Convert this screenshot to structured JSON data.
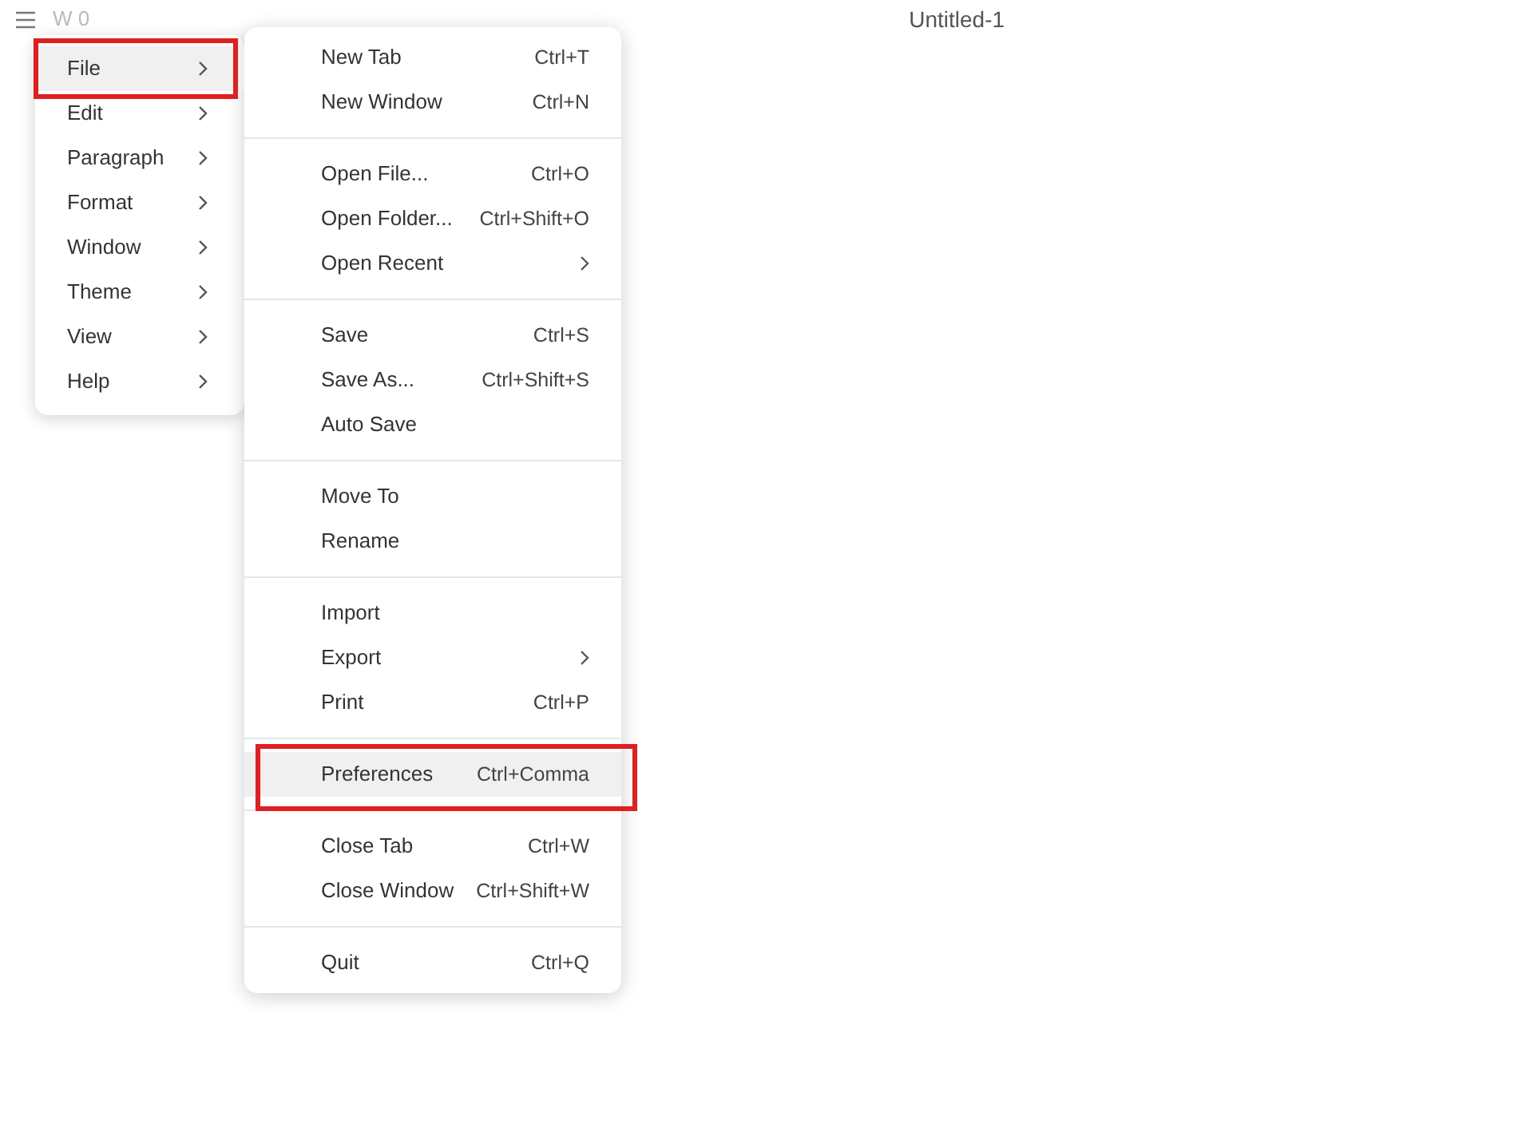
{
  "top_bar": {
    "word_count": "W 0",
    "title": "Untitled-1"
  },
  "main_menu": [
    {
      "label": "File",
      "submenu": true,
      "selected": true,
      "annotated": true
    },
    {
      "label": "Edit",
      "submenu": true,
      "selected": false,
      "annotated": false
    },
    {
      "label": "Paragraph",
      "submenu": true,
      "selected": false,
      "annotated": false
    },
    {
      "label": "Format",
      "submenu": true,
      "selected": false,
      "annotated": false
    },
    {
      "label": "Window",
      "submenu": true,
      "selected": false,
      "annotated": false
    },
    {
      "label": "Theme",
      "submenu": true,
      "selected": false,
      "annotated": false
    },
    {
      "label": "View",
      "submenu": true,
      "selected": false,
      "annotated": false
    },
    {
      "label": "Help",
      "submenu": true,
      "selected": false,
      "annotated": false
    }
  ],
  "file_menu": [
    [
      {
        "label": "New Tab",
        "shortcut": "Ctrl+T",
        "submenu": false,
        "selected": false,
        "annotated": false
      },
      {
        "label": "New Window",
        "shortcut": "Ctrl+N",
        "submenu": false,
        "selected": false,
        "annotated": false
      }
    ],
    [
      {
        "label": "Open File...",
        "shortcut": "Ctrl+O",
        "submenu": false,
        "selected": false,
        "annotated": false
      },
      {
        "label": "Open Folder...",
        "shortcut": "Ctrl+Shift+O",
        "submenu": false,
        "selected": false,
        "annotated": false
      },
      {
        "label": "Open Recent",
        "submenu": true,
        "selected": false,
        "annotated": false
      }
    ],
    [
      {
        "label": "Save",
        "shortcut": "Ctrl+S",
        "submenu": false,
        "selected": false,
        "annotated": false
      },
      {
        "label": "Save As...",
        "shortcut": "Ctrl+Shift+S",
        "submenu": false,
        "selected": false,
        "annotated": false
      },
      {
        "label": "Auto Save",
        "submenu": false,
        "selected": false,
        "annotated": false
      }
    ],
    [
      {
        "label": "Move To",
        "submenu": false,
        "selected": false,
        "annotated": false
      },
      {
        "label": "Rename",
        "submenu": false,
        "selected": false,
        "annotated": false
      }
    ],
    [
      {
        "label": "Import",
        "submenu": false,
        "selected": false,
        "annotated": false
      },
      {
        "label": "Export",
        "submenu": true,
        "selected": false,
        "annotated": false
      },
      {
        "label": "Print",
        "shortcut": "Ctrl+P",
        "submenu": false,
        "selected": false,
        "annotated": false
      }
    ],
    [
      {
        "label": "Preferences",
        "shortcut": "Ctrl+Comma",
        "submenu": false,
        "selected": true,
        "annotated": true
      }
    ],
    [
      {
        "label": "Close Tab",
        "shortcut": "Ctrl+W",
        "submenu": false,
        "selected": false,
        "annotated": false
      },
      {
        "label": "Close Window",
        "shortcut": "Ctrl+Shift+W",
        "submenu": false,
        "selected": false,
        "annotated": false
      }
    ],
    [
      {
        "label": "Quit",
        "shortcut": "Ctrl+Q",
        "submenu": false,
        "selected": false,
        "annotated": false
      }
    ]
  ]
}
